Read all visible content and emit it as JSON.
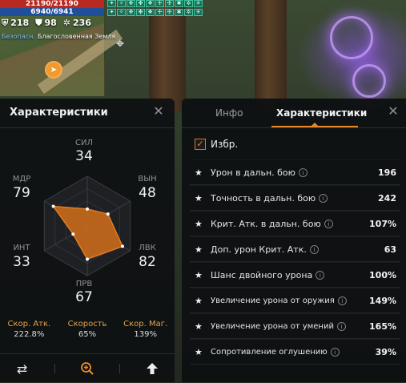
{
  "hud": {
    "hp": "21190/21190",
    "mp": "6940/6941",
    "stat1": "218",
    "stat2": "98",
    "stat3": "236",
    "zone_tag": "Безопасн.",
    "zone_name": "Благословенная Земля",
    "buff_icons": [
      "buff-icon",
      "buff-icon",
      "buff-icon",
      "buff-icon",
      "buff-icon",
      "buff-icon",
      "buff-icon",
      "buff-icon",
      "buff-icon",
      "buff-icon",
      "buff-icon",
      "buff-icon",
      "buff-icon",
      "buff-icon",
      "buff-icon",
      "buff-icon",
      "buff-icon",
      "buff-icon",
      "buff-icon",
      "buff-icon"
    ]
  },
  "left_panel": {
    "title": "Характеристики",
    "radar": {
      "sil": {
        "label": "СИЛ",
        "value": "34"
      },
      "vyn": {
        "label": "ВЫН",
        "value": "48"
      },
      "lvk": {
        "label": "ЛВК",
        "value": "82"
      },
      "prv": {
        "label": "ПРВ",
        "value": "67"
      },
      "int": {
        "label": "ИНТ",
        "value": "33"
      },
      "mdr": {
        "label": "МДР",
        "value": "79"
      }
    },
    "stats": [
      {
        "label": "Скор. Атк.",
        "value": "222.8%"
      },
      {
        "label": "Скорость",
        "value": "65%"
      },
      {
        "label": "Скор. Маг.",
        "value": "139%"
      }
    ],
    "footer_icons": [
      "swap-icon",
      "zoom-in-icon",
      "upgrade-arrow-icon"
    ]
  },
  "right_panel": {
    "tabs": [
      "Инфо",
      "Характеристики"
    ],
    "active_tab": "Характеристики",
    "favorites_label": "Избр.",
    "rows": [
      {
        "label": "Урон в дальн. бою",
        "value": "196"
      },
      {
        "label": "Точность в дальн. бою",
        "value": "242"
      },
      {
        "label": "Крит. Атк. в дальн. бою",
        "value": "107%"
      },
      {
        "label": "Доп. урон Крит. Атк.",
        "value": "63"
      },
      {
        "label": "Шанс двойного урона",
        "value": "100%"
      },
      {
        "label": "Увеличение урона от оружия",
        "value": "149%"
      },
      {
        "label": "Увеличение урона от умений",
        "value": "165%"
      },
      {
        "label": "Сопротивление оглушению",
        "value": "39%"
      }
    ]
  },
  "colors": {
    "accent": "#e8862a",
    "radar_fill": "#c96a1c",
    "hp": "#b8291f",
    "mp": "#1f4f9a"
  }
}
